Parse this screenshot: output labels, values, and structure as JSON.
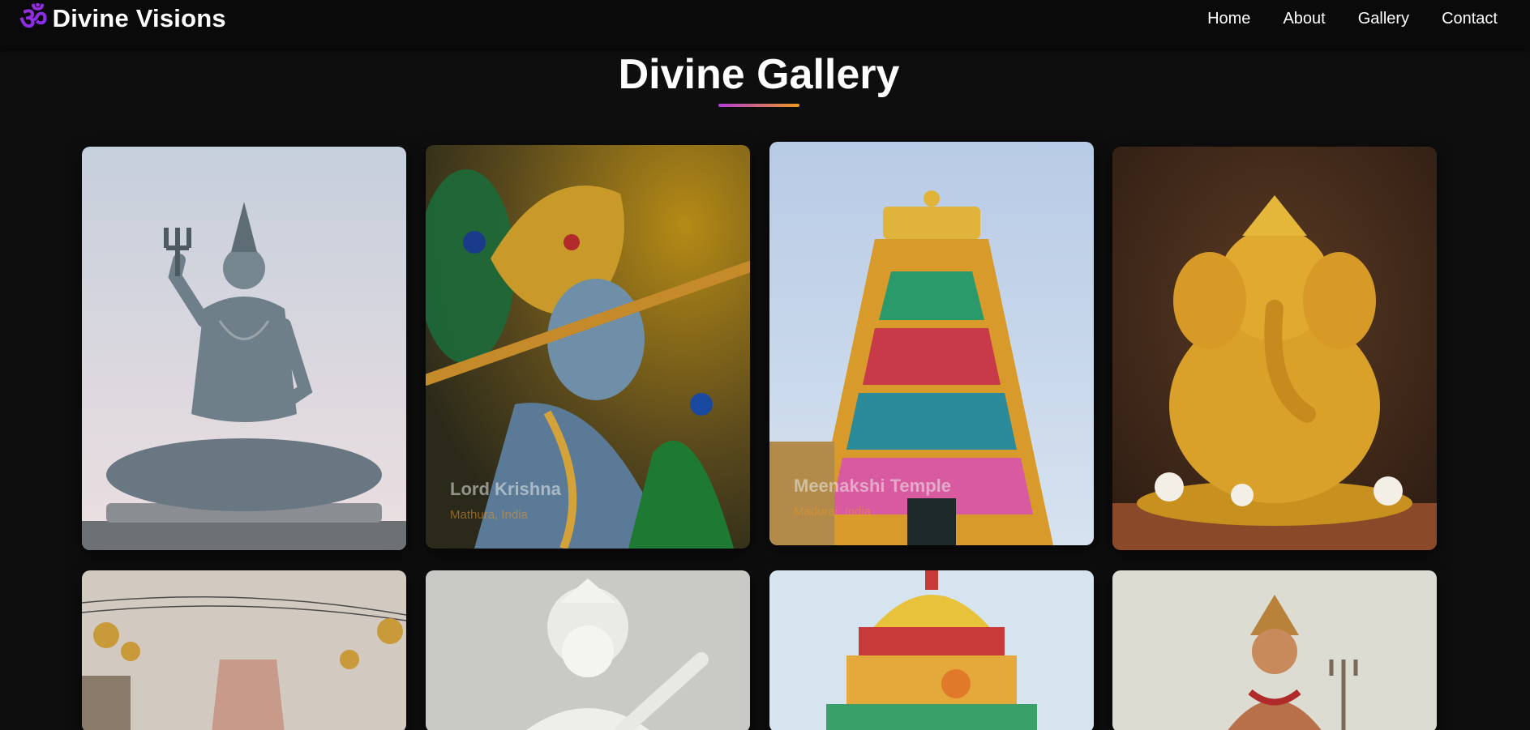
{
  "nav": {
    "logo_symbol": "ॐ",
    "brand": "Divine Visions",
    "links": [
      "Home",
      "About",
      "Gallery",
      "Contact"
    ]
  },
  "page": {
    "title": "Divine Gallery"
  },
  "gallery": {
    "cards": [
      {
        "image": "shiva-statue",
        "title": "",
        "location": ""
      },
      {
        "image": "krishna-flute",
        "title": "Lord Krishna",
        "location": "Mathura, India"
      },
      {
        "image": "temple-gopuram",
        "title": "Meenakshi Temple",
        "location": "Madurai, India"
      },
      {
        "image": "golden-ganesha",
        "title": "",
        "location": ""
      },
      {
        "image": "palace-domes",
        "title": "",
        "location": ""
      },
      {
        "image": "white-saraswati",
        "title": "",
        "location": ""
      },
      {
        "image": "colorful-shrine",
        "title": "",
        "location": ""
      },
      {
        "image": "ram-statue",
        "title": "",
        "location": ""
      }
    ]
  },
  "colors": {
    "background": "#0e0e0e",
    "navbar": "#0a0a0a",
    "accent_purple": "#a22bd6",
    "accent_orange": "#f09a1c"
  }
}
